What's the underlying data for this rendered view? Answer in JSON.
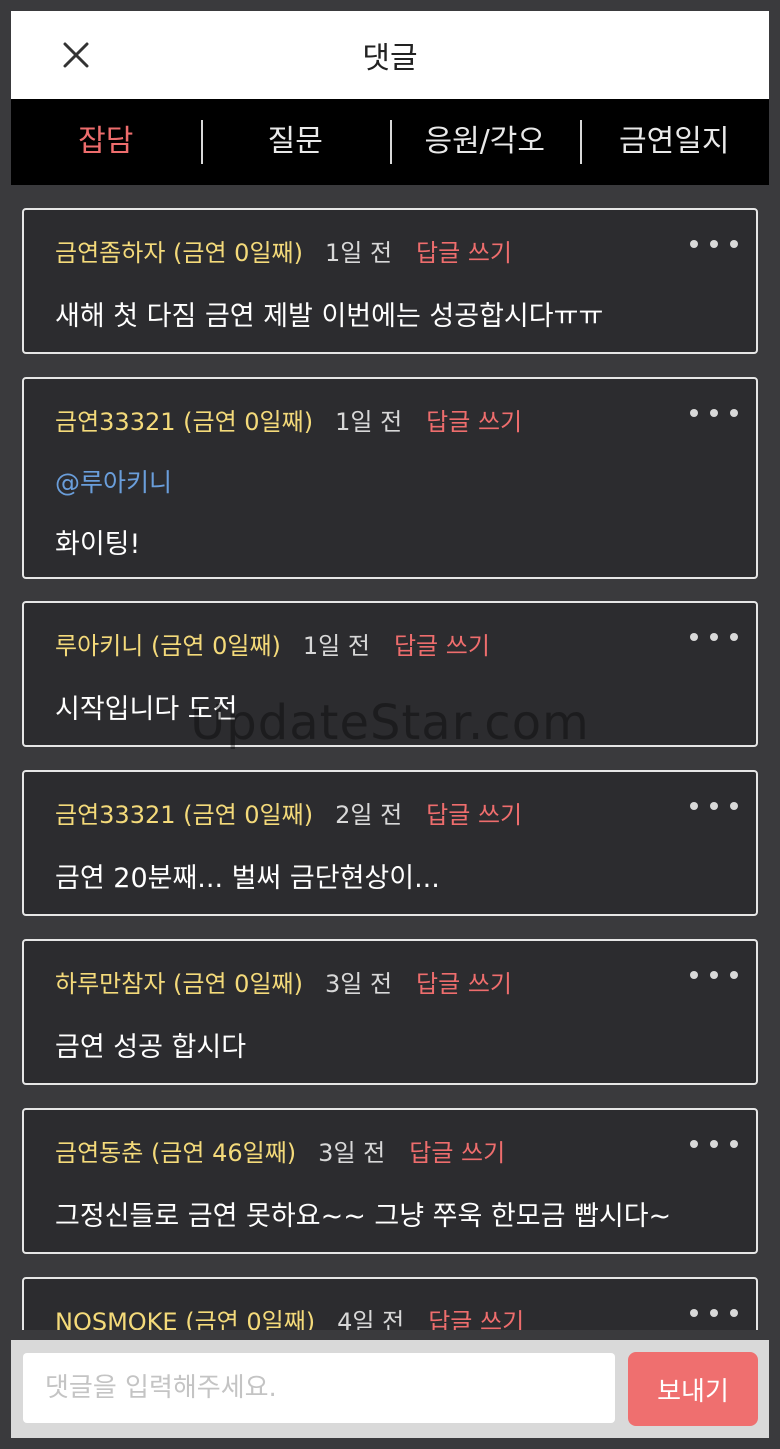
{
  "header": {
    "title": "댓글",
    "close_icon": "close-icon"
  },
  "tabs": [
    {
      "label": "잡담",
      "active": true
    },
    {
      "label": "질문",
      "active": false
    },
    {
      "label": "응원/각오",
      "active": false
    },
    {
      "label": "금연일지",
      "active": false
    }
  ],
  "comments": [
    {
      "author": "금연좀하자 (금연 0일째)",
      "time": "1일 전",
      "reply_label": "답글 쓰기",
      "mention": "",
      "text": "새해 첫 다짐 금연 제발 이번에는 성공합시다ㅠㅠ"
    },
    {
      "author": "금연33321 (금연 0일째)",
      "time": "1일 전",
      "reply_label": "답글 쓰기",
      "mention": "@루아키니",
      "text": "화이팅!"
    },
    {
      "author": "루아키니 (금연 0일째)",
      "time": "1일 전",
      "reply_label": "답글 쓰기",
      "mention": "",
      "text": "시작입니다  도전"
    },
    {
      "author": "금연33321 (금연 0일째)",
      "time": "2일 전",
      "reply_label": "답글 쓰기",
      "mention": "",
      "text": "금연 20분째... 벌써 금단현상이..."
    },
    {
      "author": "하루만참자 (금연 0일째)",
      "time": "3일 전",
      "reply_label": "답글 쓰기",
      "mention": "",
      "text": "금연 성공 합시다"
    },
    {
      "author": "금연동춘 (금연 46일째)",
      "time": "3일 전",
      "reply_label": "답글 쓰기",
      "mention": "",
      "text": "그정신들로 금연 못하요~~ 그냥 쭈욱 한모금 빱시다~"
    },
    {
      "author": "NOSMOKE (금연 0일째)",
      "time": "4일 전",
      "reply_label": "답글 쓰기",
      "mention": "",
      "text": ""
    }
  ],
  "watermark": "UpdateStar.com",
  "footer": {
    "input_value": "",
    "placeholder": "댓글을 입력해주세요.",
    "send_label": "보내기"
  },
  "colors": {
    "accent": "#ee6d6d",
    "author": "#f4da7a",
    "mention": "#6a9edb",
    "card_bg": "#2c2c2f",
    "tab_bar": "#000000",
    "send_button": "#ef6f6f"
  }
}
